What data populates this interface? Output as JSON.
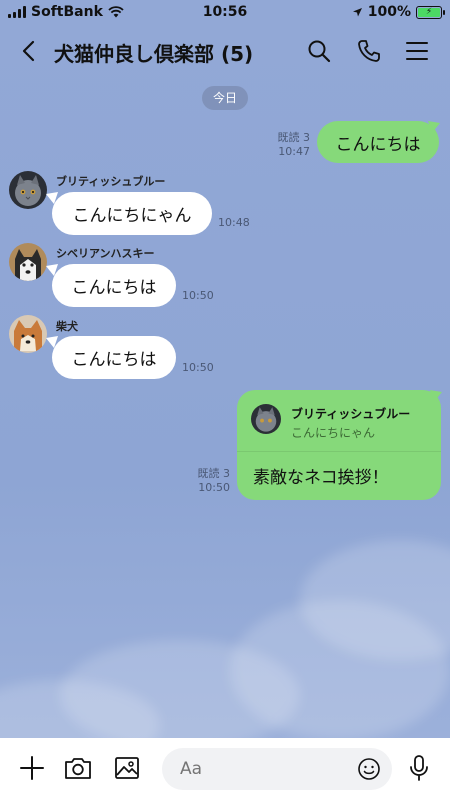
{
  "status_bar": {
    "carrier": "SoftBank",
    "time": "10:56",
    "battery": "100%"
  },
  "header": {
    "title": "犬猫仲良し倶楽部 (5)"
  },
  "date_divider": "今日",
  "messages": [
    {
      "direction": "out",
      "text": "こんにちは",
      "read": "既読 3",
      "time": "10:47"
    },
    {
      "direction": "in",
      "sender": "ブリティッシュブルー",
      "avatar": "gray-cat-avatar",
      "text": "こんにちにゃん",
      "time": "10:48"
    },
    {
      "direction": "in",
      "sender": "シベリアンハスキー",
      "avatar": "husky-avatar",
      "text": "こんにちは",
      "time": "10:50"
    },
    {
      "direction": "in",
      "sender": "柴犬",
      "avatar": "shiba-avatar",
      "text": "こんにちは",
      "time": "10:50"
    },
    {
      "direction": "out",
      "reply_to_sender": "ブリティッシュブルー",
      "reply_to_text": "こんにちにゃん",
      "text": "素敵なネコ挨拶！",
      "read": "既読 3",
      "time": "10:50"
    }
  ],
  "input": {
    "placeholder": "Aa"
  },
  "colors": {
    "background": "#8fa6d4",
    "outgoing_bubble": "#86d97a",
    "incoming_bubble": "#ffffff",
    "battery_fill": "#4cd964"
  },
  "icons": [
    "back-icon",
    "search-icon",
    "phone-icon",
    "menu-icon",
    "plus-icon",
    "camera-icon",
    "image-icon",
    "emoji-icon",
    "mic-icon"
  ]
}
